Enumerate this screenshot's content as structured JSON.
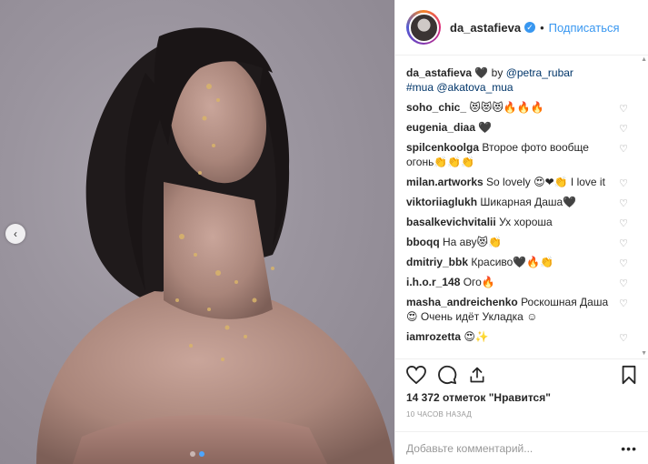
{
  "post": {
    "username": "da_astafieva",
    "verified_mark": "✓",
    "separator": "•",
    "follow_label": "Подписаться",
    "likes_text": "14 372 отметок \"Нравится\"",
    "time_text": "10 ЧАСОВ НАЗАД",
    "add_comment_placeholder": "Добавьте комментарий...",
    "more_label": "•••",
    "prev_arrow": "‹"
  },
  "caption": {
    "user": "da_astafieva",
    "text_before": "🖤 by",
    "mention1": "@petra_rubar",
    "hashtag": "#mua",
    "mention2": "@akatova_mua"
  },
  "comments": [
    {
      "user": "soho_chic_",
      "text": "😻😻😻🔥🔥🔥"
    },
    {
      "user": "eugenia_diaa",
      "text": "🖤"
    },
    {
      "user": "spilcenkoolga",
      "text": "Второе фото вообще огонь👏👏👏"
    },
    {
      "user": "milan.artworks",
      "text": "So lovely 😍❤👏 I love it"
    },
    {
      "user": "viktoriiaglukh",
      "text": "Шикарная Даша🖤"
    },
    {
      "user": "basalkevichvitalii",
      "text": "Ух хороша"
    },
    {
      "user": "bboqq",
      "text": "На аву😻👏"
    },
    {
      "user": "dmitriy_bbk",
      "text": "Красиво🖤🔥👏"
    },
    {
      "user": "i.h.o.r_148",
      "text": "Ого🔥"
    },
    {
      "user": "masha_andreichenko",
      "text": "Роскошная Даша😍 Очень идёт Укладка ☺"
    },
    {
      "user": "iamrozetta",
      "text": "😍✨"
    }
  ],
  "icons": {
    "heart": "heart-icon",
    "comment": "comment-icon",
    "share": "share-icon",
    "bookmark": "bookmark-icon",
    "small_heart": "♡"
  },
  "colors": {
    "link": "#3897f0",
    "mention": "#003569",
    "text": "#262626",
    "muted": "#999999"
  },
  "carousel": {
    "count": 2,
    "active": 1
  }
}
